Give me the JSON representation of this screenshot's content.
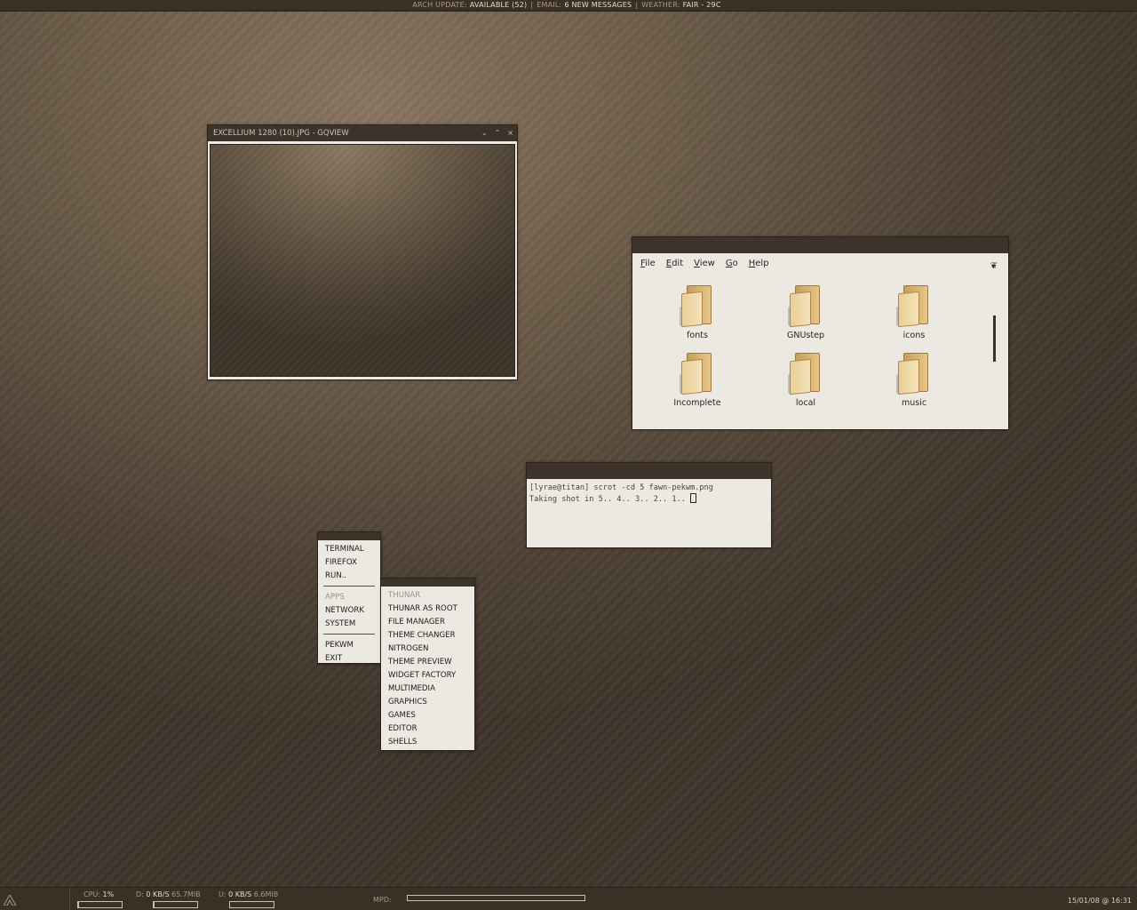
{
  "topbar": {
    "arch_label": "ARCH UPDATE:",
    "arch_value": "AVAILABLE (52)",
    "email_label": "EMAIL:",
    "email_value": "6 NEW MESSAGES",
    "weather_label": "WEATHER:",
    "weather_value": "FAIR - 29C",
    "separator": "|"
  },
  "gqview": {
    "title": "EXCELLIUM 1280 (10).JPG - GQVIEW",
    "controls": [
      "⌄",
      "⌃",
      "×"
    ]
  },
  "filemanager": {
    "menus": [
      {
        "key": "F",
        "rest": "ile"
      },
      {
        "key": "E",
        "rest": "dit"
      },
      {
        "key": "V",
        "rest": "iew"
      },
      {
        "key": "G",
        "rest": "o"
      },
      {
        "key": "H",
        "rest": "elp"
      }
    ],
    "items": [
      "fonts",
      "GNUstep",
      "icons",
      "Incomplete",
      "local",
      "music"
    ],
    "icon": "folder-icon"
  },
  "terminal": {
    "line1": "[lyrae@titan] scrot -cd 5 fawn-pekwm.png",
    "line2": "Taking shot in 5.. 4.. 3.. 2.. 1.. "
  },
  "main_menu": {
    "group1": [
      "TERMINAL",
      "FIREFOX",
      "RUN.."
    ],
    "group2_header": "APPS",
    "group2": [
      "NETWORK",
      "SYSTEM"
    ],
    "group3": [
      "PEKWM",
      "EXIT"
    ]
  },
  "sub_menu": {
    "header": "THUNAR",
    "items": [
      "THUNAR AS ROOT",
      "FILE MANAGER",
      "THEME CHANGER",
      "NITROGEN",
      "THEME PREVIEW",
      "WIDGET FACTORY",
      "MULTIMEDIA",
      "GRAPHICS",
      "GAMES",
      "EDITOR",
      "SHELLS"
    ]
  },
  "bottombar": {
    "cpu_label": "CPU:",
    "cpu_value": "1%",
    "cpu_level": 0.01,
    "down_label": "D:",
    "down_rate": "0 KB/S",
    "down_total": "65.7MIB",
    "down_level": 0.02,
    "up_label": "U:",
    "up_rate": "0  KB/S",
    "up_total": "6.6MIB",
    "up_level": 0.0,
    "mpd_label": "MPD:",
    "mpd_progress": 0.0,
    "clock": "15/01/08 @ 16:31",
    "accent": "#3a3026"
  }
}
